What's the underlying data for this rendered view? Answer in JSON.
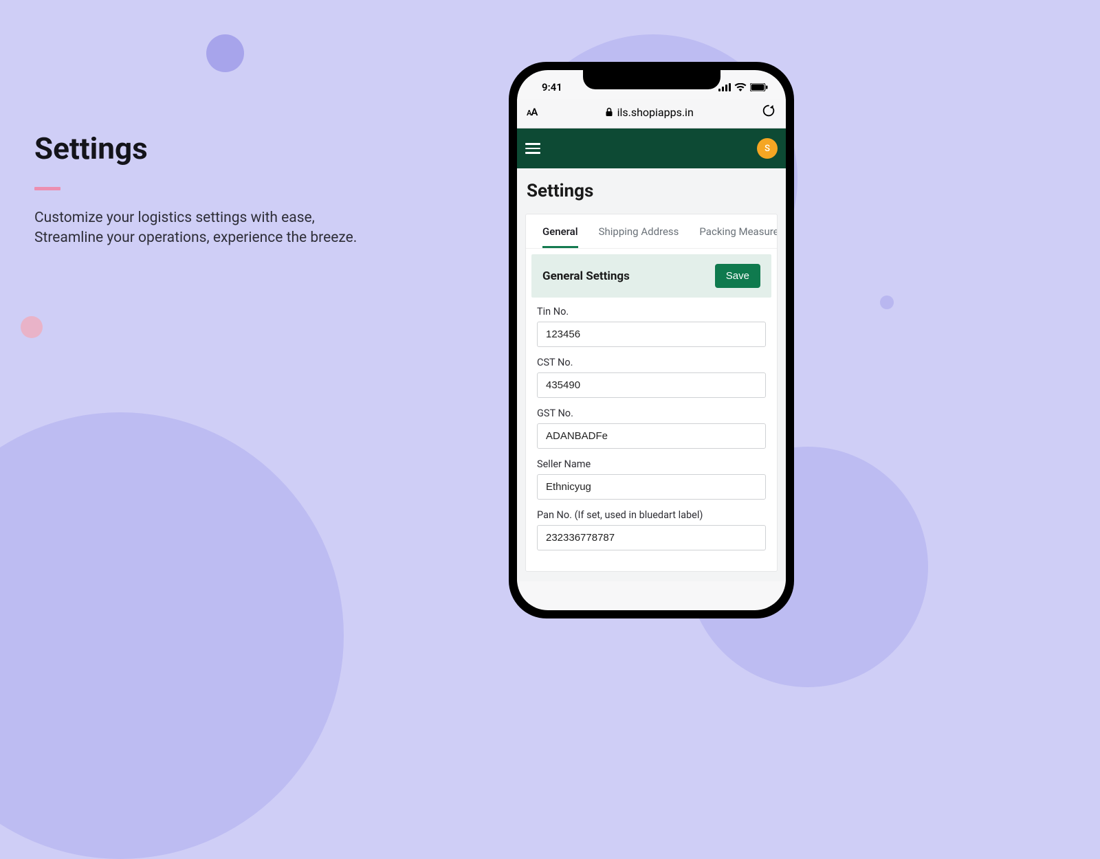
{
  "marketing": {
    "title": "Settings",
    "desc_line1": "Customize your logistics settings with ease,",
    "desc_line2": "Streamline your operations, experience the breeze."
  },
  "status_bar": {
    "time": "9:41"
  },
  "safari": {
    "aa_small": "A",
    "aa_big": "A",
    "url": "ils.shopiapps.in"
  },
  "app": {
    "avatar_initial": "S",
    "page_title": "Settings",
    "tabs": [
      "General",
      "Shipping Address",
      "Packing Measure"
    ],
    "panel_title": "General Settings",
    "save_label": "Save",
    "fields": [
      {
        "label": "Tin No.",
        "value": "123456"
      },
      {
        "label": "CST No.",
        "value": "435490"
      },
      {
        "label": "GST No.",
        "value": "ADANBADFe"
      },
      {
        "label": "Seller Name",
        "value": "Ethnicyug"
      },
      {
        "label": "Pan No. (If set, used in bluedart label)",
        "value": "232336778787"
      }
    ]
  }
}
